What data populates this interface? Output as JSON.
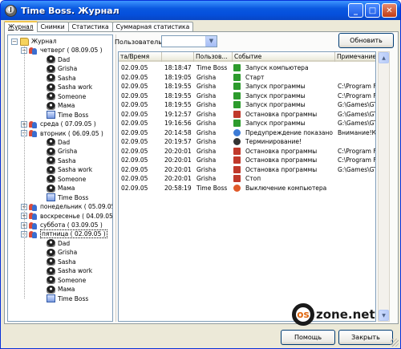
{
  "window": {
    "title": "Time Boss. Журнал"
  },
  "titlebar_buttons": {
    "minimize": "_",
    "maximize": "□",
    "close": "✕"
  },
  "tabs": [
    "Журнал",
    "Снимки",
    "Статистика",
    "Суммарная статистика"
  ],
  "tree": {
    "root": "Журнал",
    "days": [
      {
        "label": "четверг  ( 08.09.05 )",
        "expanded": true,
        "children": [
          "Dad",
          "Grisha",
          "Sasha",
          "Sasha work",
          "Someone",
          "Мама",
          "Time Boss"
        ]
      },
      {
        "label": "среда  ( 07.09.05 )",
        "expanded": false,
        "children": []
      },
      {
        "label": "вторник  ( 06.09.05 )",
        "expanded": true,
        "children": [
          "Dad",
          "Grisha",
          "Sasha",
          "Sasha work",
          "Someone",
          "Мама",
          "Time Boss"
        ]
      },
      {
        "label": "понедельник  ( 05.09.05 )",
        "expanded": false,
        "children": []
      },
      {
        "label": "воскресенье  ( 04.09.05 )",
        "expanded": false,
        "children": []
      },
      {
        "label": "суббота  ( 03.09.05 )",
        "expanded": false,
        "children": []
      },
      {
        "label": "пятница  ( 02.09.05 )",
        "expanded": true,
        "selected": true,
        "children": [
          "Dad",
          "Grisha",
          "Sasha",
          "Sasha work",
          "Someone",
          "Мама",
          "Time Boss"
        ]
      }
    ]
  },
  "toolbar": {
    "user_label": "Пользователь:",
    "user_value": "",
    "refresh_label": "Обновить"
  },
  "table": {
    "columns": [
      "та/Время",
      "",
      "Пользов...",
      "Событие",
      "Примечание"
    ],
    "rows": [
      {
        "date": "02.09.05",
        "time": "18:18:47",
        "user": "Time Boss",
        "icon": "green",
        "event": "Запуск компьютера",
        "note": ""
      },
      {
        "date": "02.09.05",
        "time": "18:19:05",
        "user": "Grisha",
        "icon": "green",
        "event": "Старт",
        "note": ""
      },
      {
        "date": "02.09.05",
        "time": "18:19:55",
        "user": "Grisha",
        "icon": "green",
        "event": "Запуск программы",
        "note": "C:\\Program Files\\Commo"
      },
      {
        "date": "02.09.05",
        "time": "18:19:55",
        "user": "Grisha",
        "icon": "green",
        "event": "Запуск программы",
        "note": "C:\\Program Files\\WinZip"
      },
      {
        "date": "02.09.05",
        "time": "18:19:55",
        "user": "Grisha",
        "icon": "green",
        "event": "Запуск программы",
        "note": "G:\\Games\\GTA-SanAnd"
      },
      {
        "date": "02.09.05",
        "time": "19:12:57",
        "user": "Grisha",
        "icon": "red",
        "event": "Остановка программы",
        "note": "G:\\Games\\GTA-SanAnd"
      },
      {
        "date": "02.09.05",
        "time": "19:16:56",
        "user": "Grisha",
        "icon": "green",
        "event": "Запуск программы",
        "note": "G:\\Games\\GTA-SanAnd"
      },
      {
        "date": "02.09.05",
        "time": "20:14:58",
        "user": "Grisha",
        "icon": "warn",
        "event": "Предупреждение показано",
        "note": "Внимание!Компьютер"
      },
      {
        "date": "02.09.05",
        "time": "20:19:57",
        "user": "Grisha",
        "icon": "user",
        "event": "Терминирование!",
        "note": ""
      },
      {
        "date": "02.09.05",
        "time": "20:20:01",
        "user": "Grisha",
        "icon": "red",
        "event": "Остановка программы",
        "note": "C:\\Program Files\\Commo"
      },
      {
        "date": "02.09.05",
        "time": "20:20:01",
        "user": "Grisha",
        "icon": "red",
        "event": "Остановка программы",
        "note": "C:\\Program Files\\WinZip"
      },
      {
        "date": "02.09.05",
        "time": "20:20:01",
        "user": "Grisha",
        "icon": "red",
        "event": "Остановка программы",
        "note": "G:\\Games\\GTA-SanAnd"
      },
      {
        "date": "02.09.05",
        "time": "20:20:01",
        "user": "Grisha",
        "icon": "red",
        "event": "Стоп",
        "note": ""
      },
      {
        "date": "02.09.05",
        "time": "20:58:19",
        "user": "Time Boss",
        "icon": "power",
        "event": "Выключение компьютера",
        "note": ""
      }
    ]
  },
  "footer": {
    "help_label": "Помощь",
    "close_label": "Закрыть",
    "logo_text": "zone.net",
    "logo_mark": "os"
  }
}
